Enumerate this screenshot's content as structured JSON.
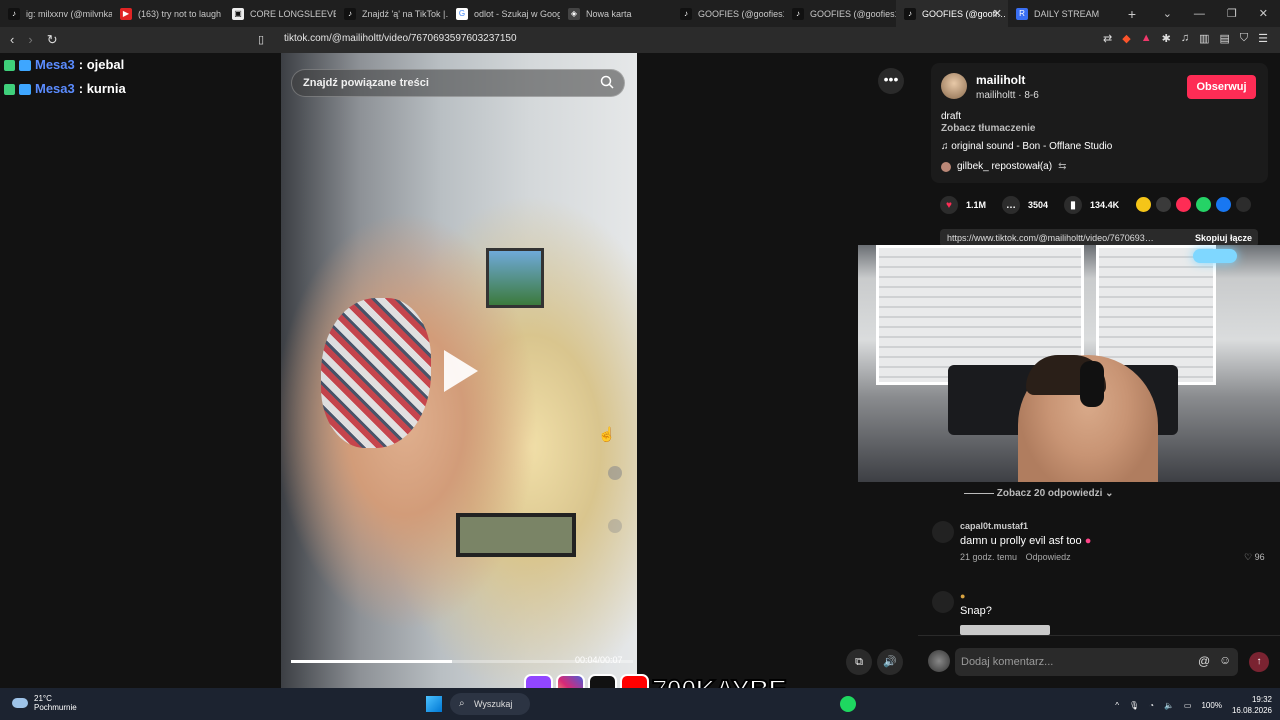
{
  "browser": {
    "tabs": [
      {
        "title": "ig: milxxnv (@milvnka…",
        "favicon": "tiktok"
      },
      {
        "title": "(163) try not to laugh",
        "favicon": "youtube"
      },
      {
        "title": "CORE LONGSLEEVE O…",
        "favicon": "site"
      },
      {
        "title": "Znajdź 'ą' na TikTok |…",
        "favicon": "tiktok"
      },
      {
        "title": "odlot - Szukaj w Goog…",
        "favicon": "google"
      },
      {
        "title": "Nowa karta",
        "favicon": "shield"
      },
      {
        "title": "GOOFIES (@goofies1…",
        "favicon": "tiktok"
      },
      {
        "title": "GOOFIES (@goofies1…",
        "favicon": "tiktok"
      },
      {
        "title": "GOOFIES (@goofi…",
        "favicon": "tiktok",
        "active": true
      },
      {
        "title": "DAILY STREAM",
        "favicon": "r"
      }
    ],
    "url": "tiktok.com/@mailiholtt/video/7670693597603237150",
    "new_tab_label": "+"
  },
  "chat": [
    {
      "user": "Mesa3",
      "message": ": ojebal"
    },
    {
      "user": "Mesa3",
      "message": ": kurnia"
    }
  ],
  "video": {
    "search_placeholder": "Znajdź powiązane treści",
    "time": "00:04/00:07",
    "progress": 0.47
  },
  "post": {
    "author_name": "mailiholt",
    "author_handle": "mailiholtt · 8-6",
    "follow_label": "Obserwuj",
    "description": "draft",
    "translate_label": "Zobacz tłumaczenie",
    "sound": "original sound - Bon - Offlane Studio",
    "repost": "gilbek_ repostował(a)",
    "likes": "1.1M",
    "comments": "3504",
    "saves": "134.4K",
    "link": "https://www.tiktok.com/@mailiholtt/video/7670693…",
    "copy_label": "Skopiuj łącze"
  },
  "comments_section": {
    "see_replies": "Zobacz 20 odpowiedzi",
    "items": [
      {
        "user": "capal0t.mustaf1",
        "text": "damn u prolly evil asf too",
        "time": "21 godz. temu",
        "reply": "Odpowiedz",
        "likes": "96"
      },
      {
        "user": "",
        "text": "Snap?",
        "time": "",
        "reply": "",
        "likes": ""
      }
    ],
    "input_placeholder": "Dodaj komentarz..."
  },
  "overlay": {
    "handle": "700KAYBE"
  },
  "taskbar": {
    "temperature": "21°C",
    "weather": "Pochmurnie",
    "search_label": "Wyszukaj",
    "battery": "100%",
    "time": "19:32",
    "date": "16.08.2026"
  },
  "colors": {
    "follow": "#fe2c55",
    "chat_user": "#5b8cff",
    "like": "#fe2c55"
  }
}
